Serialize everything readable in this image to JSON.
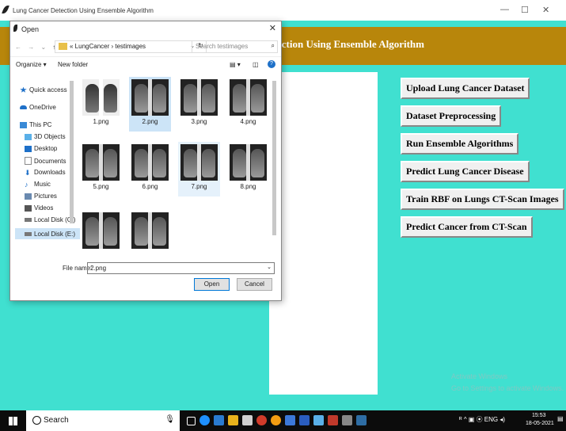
{
  "window": {
    "title": "Lung Cancer Detection Using Ensemble Algorithm",
    "minimize": "—",
    "maximize": "☐",
    "close": "✕"
  },
  "banner": {
    "title_visible": "ection Using Ensemble Algorithm"
  },
  "actions": [
    {
      "label": "Upload Lung Cancer Dataset"
    },
    {
      "label": "Dataset Preprocessing"
    },
    {
      "label": "Run Ensemble Algorithms"
    },
    {
      "label": "Predict Lung Cancer Disease"
    },
    {
      "label": "Train RBF on Lungs CT-Scan Images"
    },
    {
      "label": "Predict Cancer from CT-Scan"
    }
  ],
  "watermark": {
    "line1": "Activate Windows",
    "line2": "Go to Settings to activate Windows."
  },
  "dialog": {
    "title": "Open",
    "close": "✕",
    "nav": {
      "back": "←",
      "forward": "→",
      "recent": "⌄",
      "up": "↑"
    },
    "address": {
      "crumbs": "« LungCancer › testimages",
      "dropdown": "⌄",
      "refresh": "↻"
    },
    "search": {
      "placeholder": "Search testimages",
      "icon": "⌕"
    },
    "toolbar": {
      "organize": "Organize ▾",
      "new_folder": "New folder",
      "view": "▤ ▾",
      "pane": "◫",
      "help": "?"
    },
    "nav_pane": [
      {
        "label": "Quick access",
        "icon": "star-icon",
        "color": "#1e70c8"
      },
      {
        "label": "OneDrive",
        "icon": "cloud-icon",
        "color": "#1e70c8"
      },
      {
        "label": "This PC",
        "icon": "computer-icon",
        "color": "#3a8ad6"
      },
      {
        "label": "3D Objects",
        "icon": "cube-icon",
        "color": "#5ab0e8"
      },
      {
        "label": "Desktop",
        "icon": "desktop-icon",
        "color": "#1e70c8"
      },
      {
        "label": "Documents",
        "icon": "document-icon",
        "color": "#8a8a8a"
      },
      {
        "label": "Downloads",
        "icon": "download-icon",
        "color": "#1e70c8"
      },
      {
        "label": "Music",
        "icon": "music-icon",
        "color": "#1e70c8"
      },
      {
        "label": "Pictures",
        "icon": "picture-icon",
        "color": "#6a8ab0"
      },
      {
        "label": "Videos",
        "icon": "video-icon",
        "color": "#555"
      },
      {
        "label": "Local Disk (C:)",
        "icon": "disk-icon",
        "color": "#777"
      },
      {
        "label": "Local Disk (E:)",
        "icon": "disk-icon",
        "color": "#777"
      }
    ],
    "files": [
      {
        "name": "1.png"
      },
      {
        "name": "2.png"
      },
      {
        "name": "3.png"
      },
      {
        "name": "4.png"
      },
      {
        "name": "5.png"
      },
      {
        "name": "6.png"
      },
      {
        "name": "7.png"
      },
      {
        "name": "8.png"
      },
      {
        "name": ""
      },
      {
        "name": ""
      }
    ],
    "file_name_label": "File name:",
    "file_name_value": "2.png",
    "open_button": "Open",
    "cancel_button": "Cancel"
  },
  "taskbar": {
    "search_label": "Search",
    "time": "15:53",
    "date": "18-05-2021",
    "tray_icons": "ᴿ ^ ▣ ⦿ ENG ◂)"
  },
  "colors": {
    "background": "#40e0d0",
    "banner": "#b8860b",
    "selection": "#cce4f7"
  }
}
